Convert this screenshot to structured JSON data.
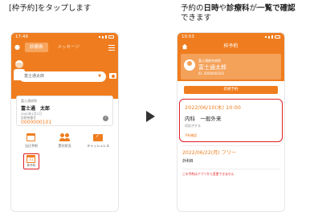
{
  "captions": {
    "left": "[枠予約]をタップします",
    "right_pre": "予約の",
    "right_b1": "日時",
    "right_mid1": "や",
    "right_b2": "診療科",
    "right_mid2": "が",
    "right_b3": "一覧で確認",
    "right_post": "できます"
  },
  "left_phone": {
    "status_time": "17:49",
    "tabs": [
      "診療券",
      "メッセージ"
    ],
    "patient_placeholder": "富士通太郎",
    "card": {
      "org": "富士通病院",
      "name": "富士通　太郎",
      "dob": "2000年1月1日",
      "id_label": "診察券番号",
      "id": "0000000101"
    },
    "menu": [
      "当日予約",
      "受付状況",
      "キャッシュレス"
    ],
    "reserve_label": "枠予約",
    "reserve_day": "31"
  },
  "right_phone": {
    "status_time": "10:53",
    "title": "枠予約",
    "org": "富士通総合病院",
    "name": "富士通太郎",
    "id": "ID: 0000000101",
    "new_button": "新規予約",
    "appointments": [
      {
        "datetime": "2022/06/10(木) 10:00",
        "dept": "内科　一般外来",
        "sub": "初診がする",
        "tag": "予約確認"
      },
      {
        "datetime": "2022/06/22(月) フリー",
        "dept": "外科B"
      }
    ],
    "note": "この予約はアプリから変更できません"
  },
  "colors": {
    "accent": "#ef7d1f",
    "highlight": "#e01e25"
  }
}
